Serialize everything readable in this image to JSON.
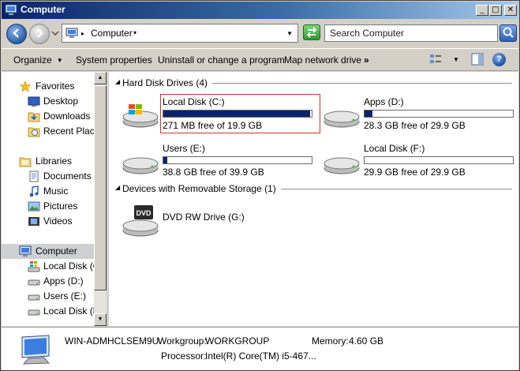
{
  "window": {
    "title": "Computer"
  },
  "titlebar_buttons": {
    "minimize": "_",
    "maximize": "□",
    "close": "✕"
  },
  "address": {
    "location": "Computer"
  },
  "search": {
    "placeholder": "Search Computer"
  },
  "toolbar": {
    "organize": "Organize",
    "system_properties": "System properties",
    "uninstall": "Uninstall or change a program",
    "map_network_drive": "Map network drive",
    "more": "»"
  },
  "nav": {
    "favorites": "Favorites",
    "desktop": "Desktop",
    "downloads": "Downloads",
    "recent_places": "Recent Places",
    "libraries": "Libraries",
    "documents": "Documents",
    "music": "Music",
    "pictures": "Pictures",
    "videos": "Videos",
    "computer": "Computer",
    "local_disk_c": "Local Disk (C:",
    "apps_d": "Apps (D:)",
    "users_e": "Users (E:)",
    "local_disk_f": "Local Disk (F:"
  },
  "groups": {
    "hdd": "Hard Disk Drives (4)",
    "removable": "Devices with Removable Storage (1)"
  },
  "drives": [
    {
      "label": "Local Disk (C:)",
      "free_text": "271 MB free of 19.9 GB",
      "used_fraction": 0.987,
      "icon": "windows-drive-icon"
    },
    {
      "label": "Apps (D:)",
      "free_text": "28.3 GB free of 29.9 GB",
      "used_fraction": 0.054,
      "icon": "hard-drive-icon"
    },
    {
      "label": "Users (E:)",
      "free_text": "38.8 GB free of 39.9 GB",
      "used_fraction": 0.028,
      "icon": "hard-drive-icon"
    },
    {
      "label": "Local Disk (F:)",
      "free_text": "29.9 GB free of 29.9 GB",
      "used_fraction": 0.0,
      "icon": "hard-drive-icon"
    }
  ],
  "removable": {
    "label": "DVD RW Drive (G:)",
    "badge": "DVD"
  },
  "details": {
    "computer_name": "WIN-ADMHCLSEM9U",
    "workgroup_label": "Workgroup:",
    "workgroup_value": "WORKGROUP",
    "memory_label": "Memory:",
    "memory_value": "4.60 GB",
    "processor_label": "Processor:",
    "processor_value": "Intel(R) Core(TM) i5-467..."
  },
  "colors": {
    "bar_fill": "#0a246a",
    "selection_outline": "#c0392b",
    "title_start": "#0a246a"
  }
}
